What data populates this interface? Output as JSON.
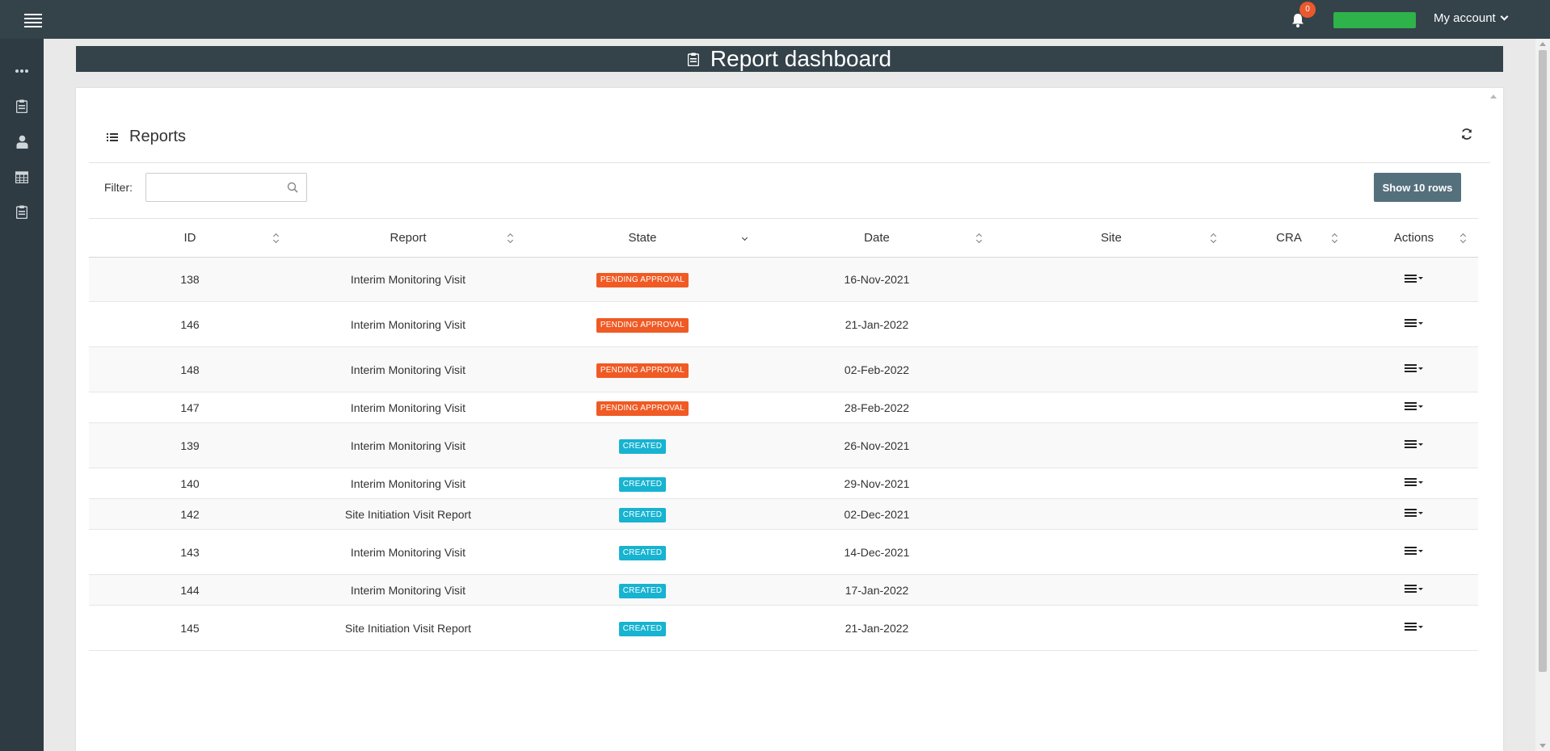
{
  "topbar": {
    "menu_icon": "hamburger-icon",
    "notification_icon": "bell-icon",
    "notification_count": "0",
    "account_label": "My account",
    "user_chip_color": "#2eb24a",
    "badge_color": "#e8592d"
  },
  "sidebar": {
    "items": [
      {
        "icon": "more-dots-icon"
      },
      {
        "icon": "clipboard-icon"
      },
      {
        "icon": "user-tie-icon"
      },
      {
        "icon": "calendar-icon"
      },
      {
        "icon": "clipboard-list-icon"
      }
    ]
  },
  "page": {
    "title": "Report dashboard",
    "title_icon": "clipboard-icon"
  },
  "panel": {
    "title": "Reports",
    "title_icon": "list-icon",
    "refresh_icon": "refresh-icon",
    "filter_label": "Filter:",
    "filter_value": "",
    "filter_placeholder": "",
    "show_rows_label": "Show 10 rows"
  },
  "table": {
    "columns": [
      {
        "label": "ID",
        "sort": "none"
      },
      {
        "label": "Report",
        "sort": "none"
      },
      {
        "label": "State",
        "sort": "desc"
      },
      {
        "label": "Date",
        "sort": "none"
      },
      {
        "label": "Site",
        "sort": "none"
      },
      {
        "label": "CRA",
        "sort": "none"
      },
      {
        "label": "Actions",
        "sort": "none"
      }
    ],
    "state_colors": {
      "PENDING APPROVAL": "#f05a24",
      "CREATED": "#17b3d1"
    },
    "rows": [
      {
        "id": "138",
        "report": "Interim Monitoring Visit",
        "state": "PENDING APPROVAL",
        "date": "16-Nov-2021",
        "site": "",
        "cra": ""
      },
      {
        "id": "146",
        "report": "Interim Monitoring Visit",
        "state": "PENDING APPROVAL",
        "date": "21-Jan-2022",
        "site": "",
        "cra": ""
      },
      {
        "id": "148",
        "report": "Interim Monitoring Visit",
        "state": "PENDING APPROVAL",
        "date": "02-Feb-2022",
        "site": "",
        "cra": ""
      },
      {
        "id": "147",
        "report": "Interim Monitoring Visit",
        "state": "PENDING APPROVAL",
        "date": "28-Feb-2022",
        "site": "",
        "cra": ""
      },
      {
        "id": "139",
        "report": "Interim Monitoring Visit",
        "state": "CREATED",
        "date": "26-Nov-2021",
        "site": "",
        "cra": ""
      },
      {
        "id": "140",
        "report": "Interim Monitoring Visit",
        "state": "CREATED",
        "date": "29-Nov-2021",
        "site": "",
        "cra": ""
      },
      {
        "id": "142",
        "report": "Site Initiation Visit Report",
        "state": "CREATED",
        "date": "02-Dec-2021",
        "site": "",
        "cra": ""
      },
      {
        "id": "143",
        "report": "Interim Monitoring Visit",
        "state": "CREATED",
        "date": "14-Dec-2021",
        "site": "",
        "cra": ""
      },
      {
        "id": "144",
        "report": "Interim Monitoring Visit",
        "state": "CREATED",
        "date": "17-Jan-2022",
        "site": "",
        "cra": ""
      },
      {
        "id": "145",
        "report": "Site Initiation Visit Report",
        "state": "CREATED",
        "date": "21-Jan-2022",
        "site": "",
        "cra": ""
      }
    ]
  }
}
